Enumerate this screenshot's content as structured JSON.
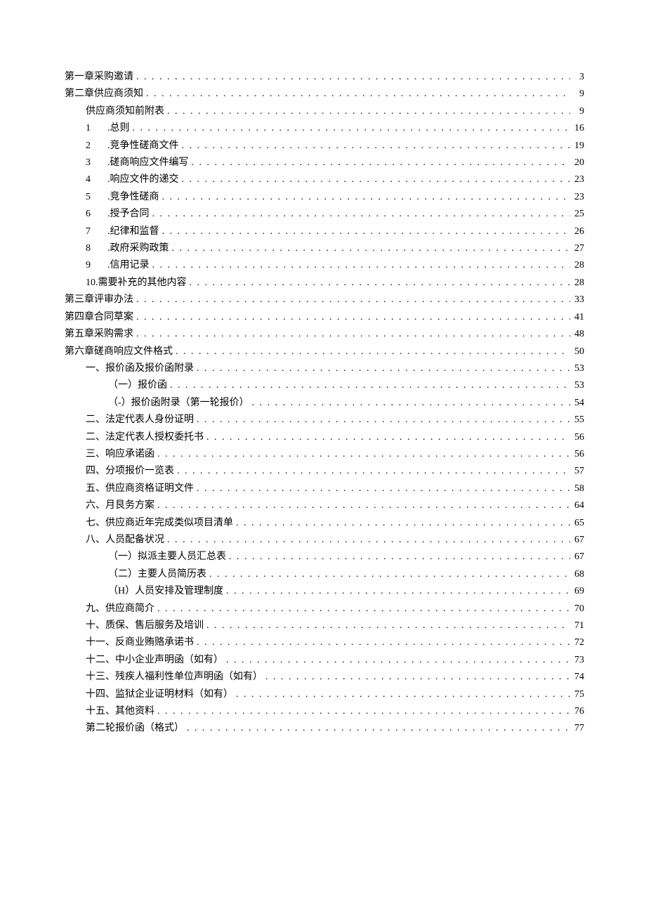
{
  "toc": [
    {
      "indent": 0,
      "label": "第一章采购邀请",
      "page": "3"
    },
    {
      "indent": 0,
      "label": "第二章供应商须知",
      "page": "9"
    },
    {
      "indent": 1,
      "label": "供应商须知前附表",
      "page": "9"
    },
    {
      "indent": 1,
      "num": "1",
      "label": ".总则",
      "page": "16"
    },
    {
      "indent": 1,
      "num": "2",
      "label": ".竞争性磋商文件",
      "page": "19"
    },
    {
      "indent": 1,
      "num": "3",
      "label": ".磋商响应文件编写",
      "page": "20"
    },
    {
      "indent": 1,
      "num": "4",
      "label": ".响应文件的递交",
      "page": "23"
    },
    {
      "indent": 1,
      "num": "5",
      "label": ".竞争性磋商",
      "page": "23"
    },
    {
      "indent": 1,
      "num": "6",
      "label": ".授予合同",
      "page": "25"
    },
    {
      "indent": 1,
      "num": "7",
      "label": ".纪律和监督",
      "page": "26"
    },
    {
      "indent": 1,
      "num": "8",
      "label": ".政府采购政策",
      "page": "27"
    },
    {
      "indent": 1,
      "num": "9",
      "label": ".信用记录",
      "page": "28"
    },
    {
      "indent": 1,
      "label": "10.需要补充的其他内容",
      "page": "28"
    },
    {
      "indent": 0,
      "label": "第三章评审办法",
      "page": "33"
    },
    {
      "indent": 0,
      "label": "第四章合同草案",
      "page": "41"
    },
    {
      "indent": 0,
      "label": "第五章采购需求",
      "page": "48"
    },
    {
      "indent": 0,
      "label": "第六章磋商响应文件格式",
      "page": "50"
    },
    {
      "indent": 1,
      "label": "一、报价函及报价函附录",
      "page": "53"
    },
    {
      "indent": 2,
      "label": "（一）报价函",
      "page": "53"
    },
    {
      "indent": 2,
      "label": "（-）报价函附录（第一轮报价）",
      "page": "54"
    },
    {
      "indent": 1,
      "label": "二、法定代表人身份证明",
      "page": "55"
    },
    {
      "indent": 1,
      "label": "二、法定代表人授权委托书",
      "page": "56"
    },
    {
      "indent": 1,
      "label": "三、响应承诺函",
      "page": "56"
    },
    {
      "indent": 1,
      "label": "四、分项报价一览表",
      "page": "57"
    },
    {
      "indent": 1,
      "label": "五、供应商资格证明文件",
      "page": "58"
    },
    {
      "indent": 1,
      "label": "六、月艮务方案",
      "page": "64"
    },
    {
      "indent": 1,
      "label": "七、供应商近年完成类似项目清单",
      "page": "65"
    },
    {
      "indent": 1,
      "label": "八、人员配备状况",
      "page": "67"
    },
    {
      "indent": 2,
      "label": "（一）拟派主要人员汇总表",
      "page": "67"
    },
    {
      "indent": 2,
      "label": "（二）主要人员简历表",
      "page": "68"
    },
    {
      "indent": 2,
      "label": "（H）人员安排及管理制度",
      "page": "69"
    },
    {
      "indent": 1,
      "label": "九、供应商简介",
      "page": "70"
    },
    {
      "indent": 1,
      "label": "十、质保、售后服务及培训",
      "page": "71"
    },
    {
      "indent": 1,
      "label": "十一、反商业贿赂承诺书",
      "page": "72"
    },
    {
      "indent": 1,
      "label": "十二、中小企业声明函（如有）",
      "page": "73"
    },
    {
      "indent": 1,
      "label": "十三、残疾人福利性单位声明函（如有）",
      "page": "74"
    },
    {
      "indent": 1,
      "label": "十四、监狱企业证明材料（如有）",
      "page": "75"
    },
    {
      "indent": 1,
      "label": "十五、其他资料",
      "page": "76"
    },
    {
      "indent": 1,
      "label": "第二轮报价函（格式）",
      "page": "77"
    }
  ]
}
